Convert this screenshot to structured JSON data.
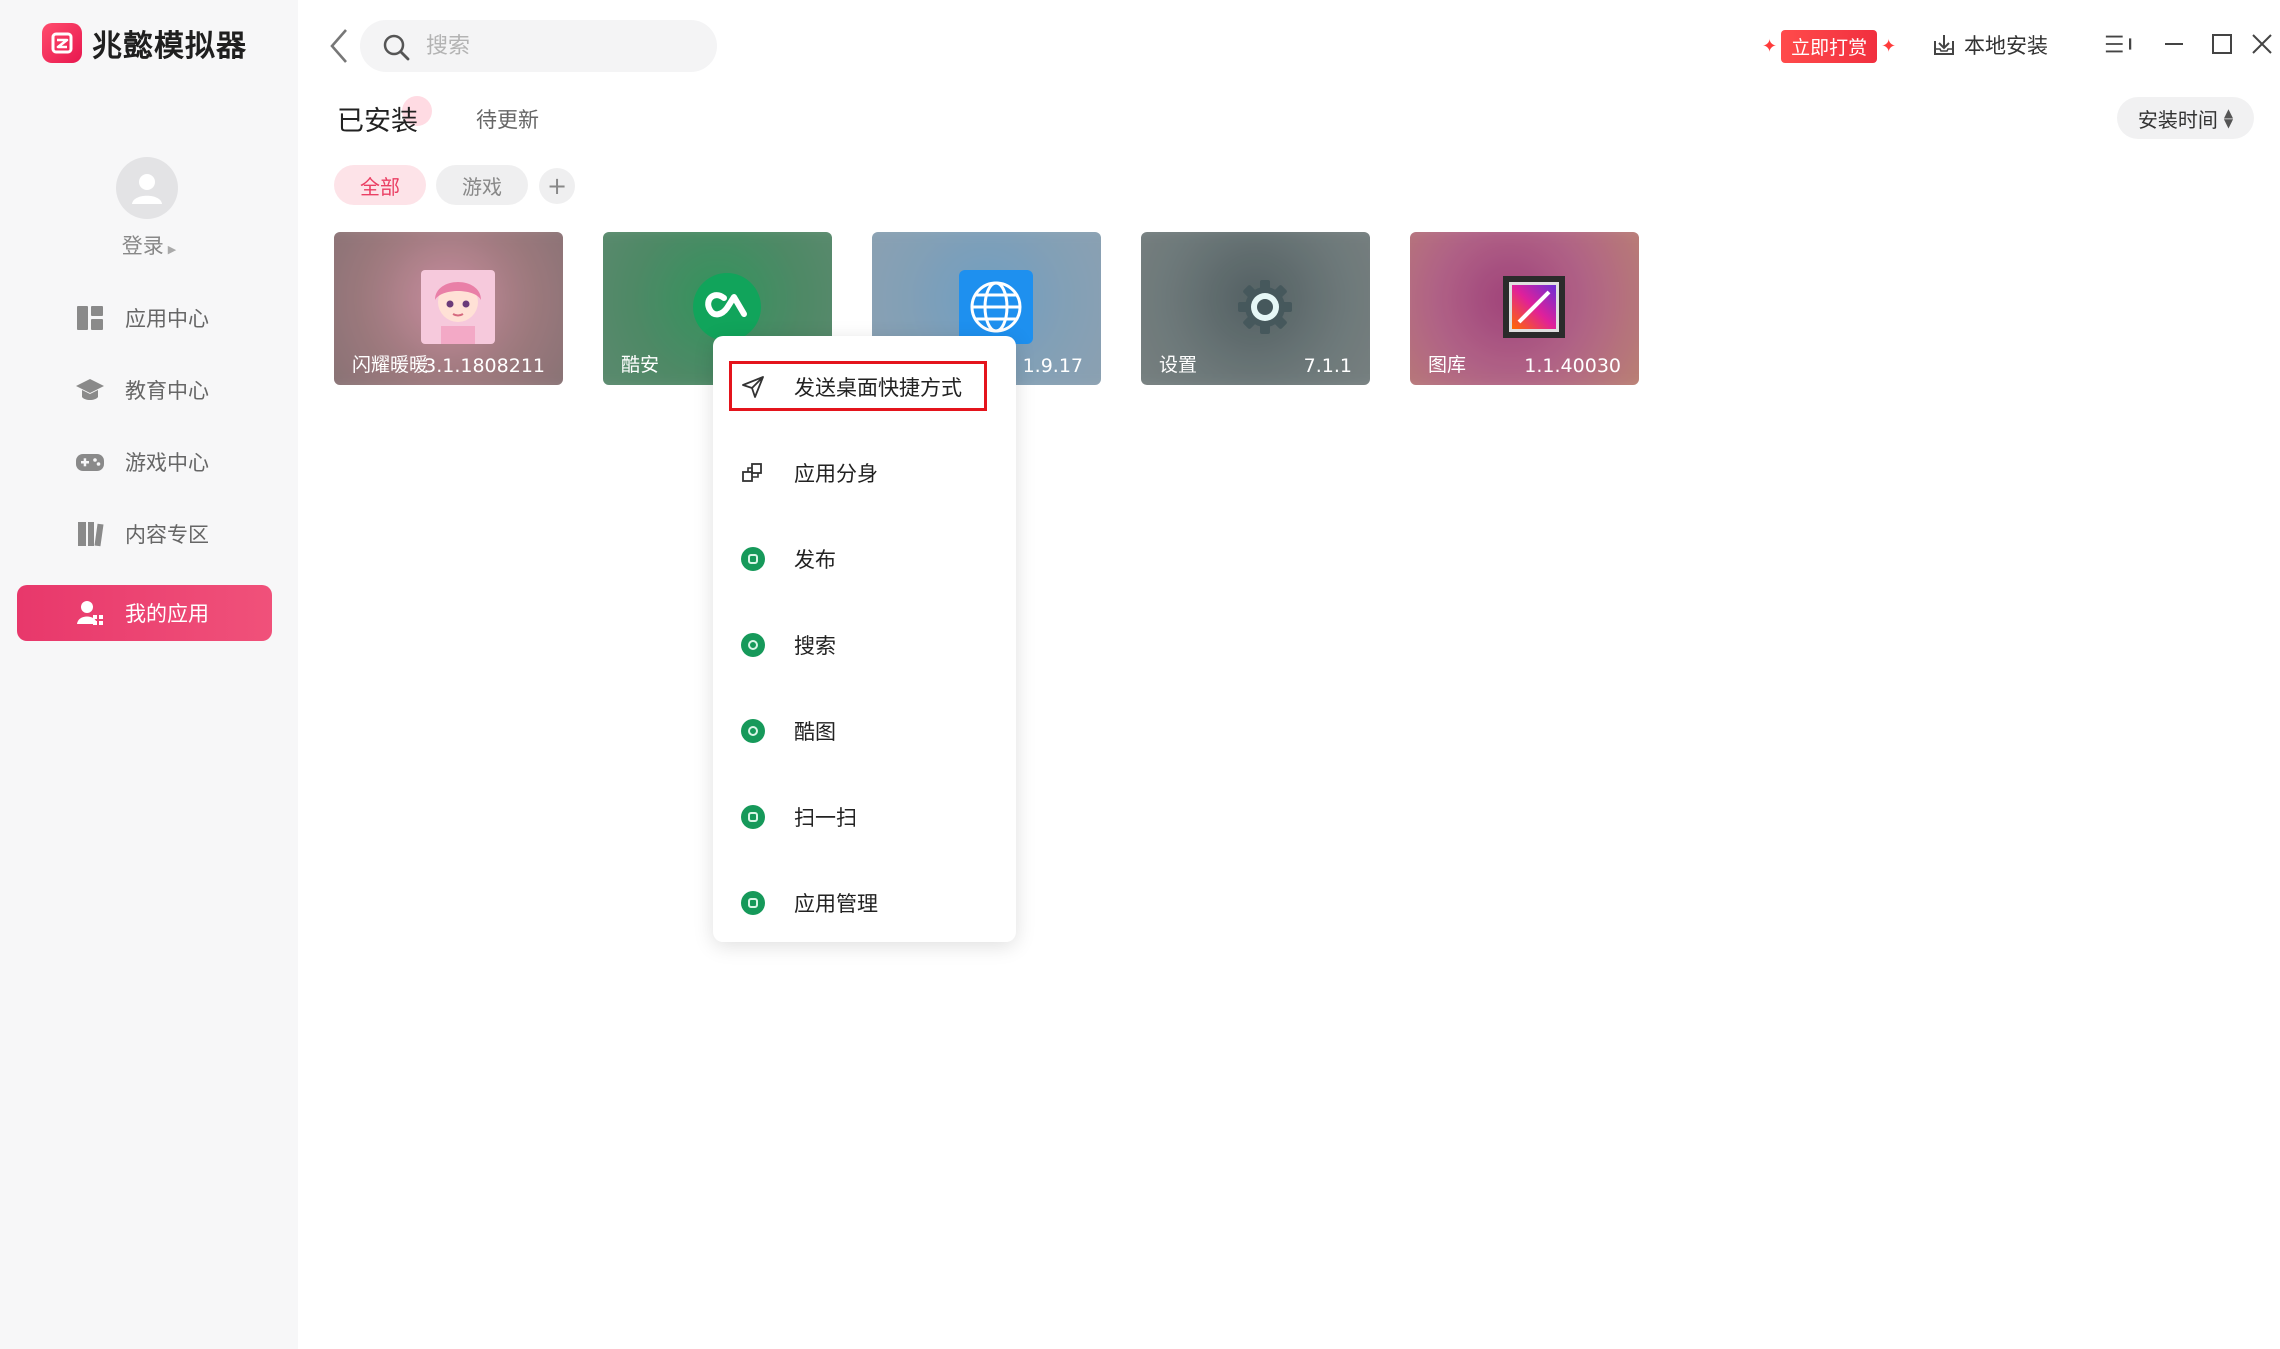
{
  "app": {
    "name": "兆懿模拟器",
    "brand_color": "#e8386b"
  },
  "sidebar": {
    "login_label": "登录",
    "items": [
      {
        "label": "应用中心",
        "icon": "app-center-icon"
      },
      {
        "label": "教育中心",
        "icon": "graduation-cap-icon"
      },
      {
        "label": "游戏中心",
        "icon": "gamepad-icon"
      },
      {
        "label": "内容专区",
        "icon": "books-icon"
      },
      {
        "label": "我的应用",
        "icon": "user-apps-icon",
        "active": true
      }
    ]
  },
  "header": {
    "search_placeholder": "搜索",
    "reward_label": "立即打赏",
    "local_install_label": "本地安装"
  },
  "tabs": {
    "installed": "已安装",
    "updates": "待更新"
  },
  "sort": {
    "label": "安装时间"
  },
  "filters": {
    "all": "全部",
    "games": "游戏",
    "add": "+"
  },
  "apps": [
    {
      "name": "闪耀暖暖",
      "version": "3.1.1808211"
    },
    {
      "name": "酷安",
      "version": ""
    },
    {
      "name": "",
      "version": "1.9.17"
    },
    {
      "name": "设置",
      "version": "7.1.1"
    },
    {
      "name": "图库",
      "version": "1.1.40030"
    }
  ],
  "context_menu": {
    "items": [
      {
        "label": "发送桌面快捷方式",
        "icon": "send-icon",
        "highlighted": true
      },
      {
        "label": "应用分身",
        "icon": "clone-icon"
      },
      {
        "label": "发布",
        "icon": "publish-icon"
      },
      {
        "label": "搜索",
        "icon": "search-icon"
      },
      {
        "label": "酷图",
        "icon": "coolpic-icon"
      },
      {
        "label": "扫一扫",
        "icon": "scan-icon"
      },
      {
        "label": "应用管理",
        "icon": "app-manage-icon"
      }
    ],
    "highlight_color": "#e4141c"
  }
}
